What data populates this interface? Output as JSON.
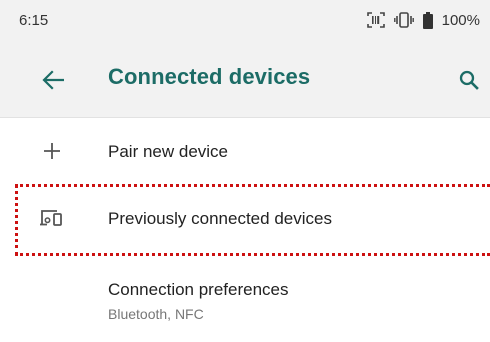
{
  "status_bar": {
    "time": "6:15",
    "battery": "100%",
    "icons": [
      "scanner-icon",
      "vibrate-icon",
      "battery-icon"
    ]
  },
  "app_bar": {
    "title": "Connected devices",
    "back_icon": "arrow-back-icon",
    "search_icon": "search-icon"
  },
  "list": {
    "pair": {
      "label": "Pair new device",
      "icon": "plus-icon"
    },
    "previous": {
      "label": "Previously connected devices",
      "icon": "devices-icon"
    },
    "preferences": {
      "label": "Connection preferences",
      "subtitle": "Bluetooth, NFC"
    }
  },
  "colors": {
    "accent": "#1c6c66",
    "highlight": "#cc1111",
    "bar_background": "#f2f2f2"
  }
}
